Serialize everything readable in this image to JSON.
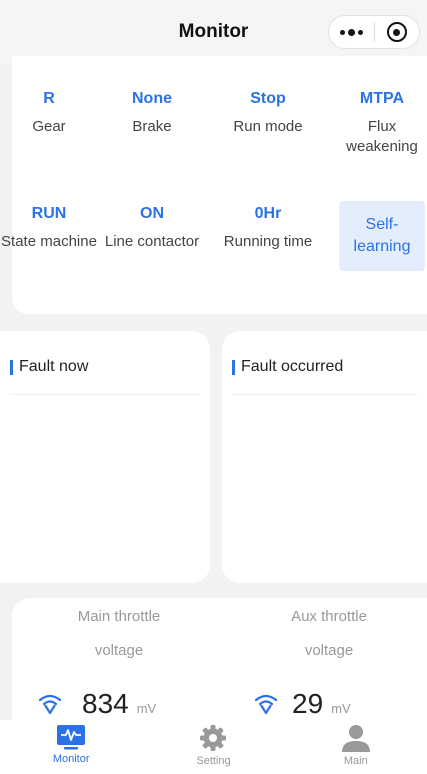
{
  "header": {
    "title": "Monitor"
  },
  "status": {
    "row1": [
      {
        "value": "R",
        "label": "Gear"
      },
      {
        "value": "None",
        "label": "Brake"
      },
      {
        "value": "Stop",
        "label": "Run mode"
      },
      {
        "value": "MTPA",
        "label": "Flux weakening"
      }
    ],
    "row2": [
      {
        "value": "RUN",
        "label": "State machine"
      },
      {
        "value": "ON",
        "label": "Line contactor"
      },
      {
        "value": "0Hr",
        "label": "Running time"
      }
    ],
    "self_learning_label": "Self-learning"
  },
  "faults": {
    "now_title": "Fault now",
    "occurred_title": "Fault occurred"
  },
  "throttle": {
    "main": {
      "label": "Main throttle voltage",
      "value": "834",
      "unit": "mV"
    },
    "aux": {
      "label": "Aux throttle voltage",
      "value": "29",
      "unit": "mV"
    }
  },
  "tabs": {
    "monitor": "Monitor",
    "setting": "Setting",
    "main": "Main"
  },
  "colors": {
    "accent": "#2b72e6",
    "self_learning_bg": "#e3edfb",
    "background": "#f2f2f2"
  },
  "icons": {
    "more": "more-dots-icon",
    "close": "target-icon",
    "signal": "signal-icon",
    "monitor": "monitor-icon",
    "setting": "gear-icon",
    "main": "user-icon"
  }
}
